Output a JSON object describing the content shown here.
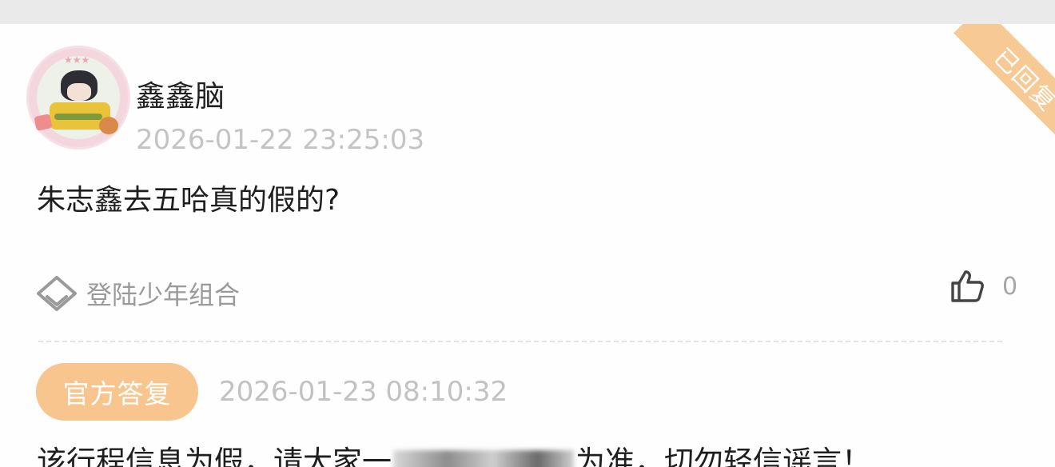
{
  "post": {
    "author": "鑫鑫脑",
    "timestamp": "2026-01-22 23:25:03",
    "question": "朱志鑫去五哈真的假的?",
    "tag": "登陆少年组合",
    "like_count": "0",
    "status_ribbon": "已回复"
  },
  "reply": {
    "badge": "官方答复",
    "timestamp": "2026-01-23 08:10:32",
    "text_before": "该行程信息为假，请大家一",
    "text_after": "为准，切勿轻信谣言！"
  },
  "icons": {
    "tag": "diamond-outline-icon",
    "like": "thumbs-up-icon"
  },
  "colors": {
    "accent": "#f8c58e",
    "ribbon": "#f7c994",
    "muted_text": "#c4c4c4"
  }
}
